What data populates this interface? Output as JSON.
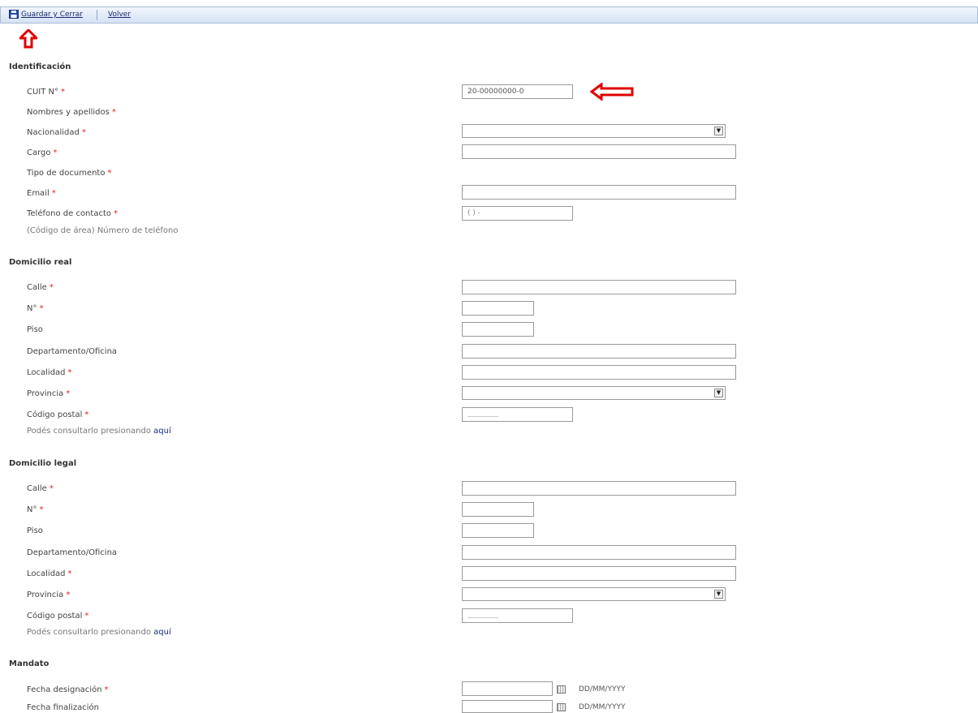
{
  "toolbar": {
    "save_label": "Guardar y Cerrar",
    "back_label": "Volver"
  },
  "identificacion": {
    "title": "Identificación",
    "cuit_label": "CUIT N°",
    "cuit_value": "20-00000000-0",
    "nombres_label": "Nombres y apellidos",
    "nacionalidad_label": "Nacionalidad",
    "cargo_label": "Cargo",
    "tipo_doc_label": "Tipo de documento",
    "email_label": "Email",
    "telefono_label": "Teléfono de contacto",
    "telefono_mask": "(   )    -",
    "telefono_hint": "(Código de área) Número de teléfono"
  },
  "domicilio_real": {
    "title": "Domicilio real",
    "calle_label": "Calle",
    "numero_label": "N°",
    "piso_label": "Piso",
    "depto_label": "Departamento/Oficina",
    "localidad_label": "Localidad",
    "provincia_label": "Provincia",
    "cp_label": "Código postal",
    "cp_hint": "Podés consultarlo presionando",
    "cp_link": "aquí"
  },
  "domicilio_legal": {
    "title": "Domicilio legal",
    "calle_label": "Calle",
    "numero_label": "N°",
    "piso_label": "Piso",
    "depto_label": "Departamento/Oficina",
    "localidad_label": "Localidad",
    "provincia_label": "Provincia",
    "cp_label": "Código postal",
    "cp_hint": "Podés consultarlo presionando",
    "cp_link": "aquí"
  },
  "mandato": {
    "title": "Mandato",
    "fecha_designacion_label": "Fecha designación",
    "fecha_finalizacion_label": "Fecha finalización",
    "date_format": "DD/MM/YYYY"
  },
  "required_marker": "*",
  "icons": {
    "save": "save-icon",
    "calendar": "calendar-icon",
    "dropdown": "chevron-down-icon",
    "annotation": "red-arrow-icon"
  },
  "colors": {
    "required": "#e02020",
    "annotation_arrow": "#e00000",
    "link": "#1a2a8a"
  }
}
